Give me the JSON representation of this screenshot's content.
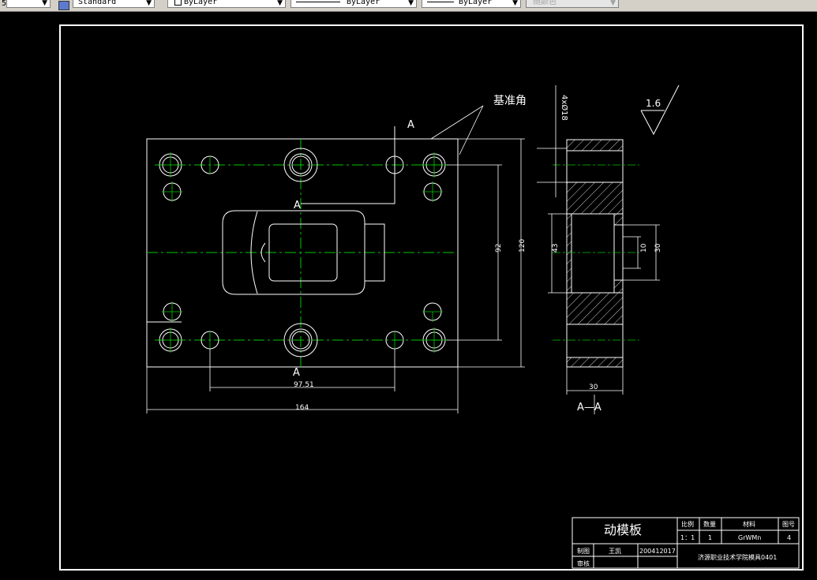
{
  "toolbar": {
    "layer_value": "5",
    "text_style": "Standard",
    "color": "ByLayer",
    "linetype": "ByLayer",
    "lineweight": "ByLayer",
    "plotstyle": "随颜色"
  },
  "drawing": {
    "label_datum": "基准角",
    "section_A": "A",
    "section_view_label": "A—A",
    "holes_note": "4xØ18",
    "roughness": "1.6",
    "dim_9751": "97.51",
    "dim_164": "164",
    "dim_92": "92",
    "dim_120": "120",
    "dim_43": "43",
    "dim_10": "10",
    "dim_30_v": "30",
    "dim_30_h": "30"
  },
  "title_block": {
    "part_name": "动模板",
    "h_scale": "比例",
    "h_qty": "数量",
    "h_material": "材料",
    "h_drawing_no": "图号",
    "scale": "1：1",
    "qty": "1",
    "material": "GrWMn",
    "drawing_no": "4",
    "drawn_by_label": "制图",
    "drawn_by": "王凯",
    "date": "200412017",
    "checked_label": "审核",
    "school": "济源职业技术学院模具0401"
  }
}
